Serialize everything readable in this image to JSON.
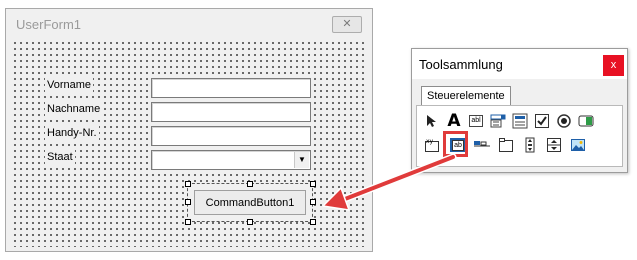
{
  "userform": {
    "title": "UserForm1",
    "close_glyph": "✕",
    "fields": [
      {
        "label": "Vorname",
        "kind": "textbox",
        "value": ""
      },
      {
        "label": "Nachname",
        "kind": "textbox",
        "value": ""
      },
      {
        "label": "Handy-Nr.",
        "kind": "textbox",
        "value": ""
      },
      {
        "label": "Staat",
        "kind": "combobox",
        "value": ""
      }
    ],
    "combo_arrow_glyph": "▼",
    "command_button_label": "CommandButton1"
  },
  "toolbox": {
    "title": "Toolsammlung",
    "close_glyph": "x",
    "tab_label": "Steuerelemente",
    "tools": [
      {
        "name": "select-objects-icon",
        "glyph": "➚"
      },
      {
        "name": "label-icon",
        "glyph": "A"
      },
      {
        "name": "textbox-icon",
        "glyph": "abl"
      },
      {
        "name": "combobox-icon",
        "glyph": ""
      },
      {
        "name": "listbox-icon",
        "glyph": ""
      },
      {
        "name": "checkbox-icon",
        "glyph": "✓"
      },
      {
        "name": "optionbutton-icon",
        "glyph": ""
      },
      {
        "name": "togglebutton-icon",
        "glyph": ""
      },
      {
        "name": "frame-icon",
        "glyph": "xy"
      },
      {
        "name": "commandbutton-icon",
        "glyph": "ab"
      },
      {
        "name": "tabstrip-icon",
        "glyph": ""
      },
      {
        "name": "multipage-icon",
        "glyph": ""
      },
      {
        "name": "scrollbar-icon",
        "glyph": ""
      },
      {
        "name": "spinbutton-icon",
        "glyph": ""
      },
      {
        "name": "image-icon",
        "glyph": ""
      }
    ]
  },
  "colors": {
    "highlight": "#e03b3b",
    "close_red": "#e81123",
    "form_background": "#f0f0f0"
  }
}
